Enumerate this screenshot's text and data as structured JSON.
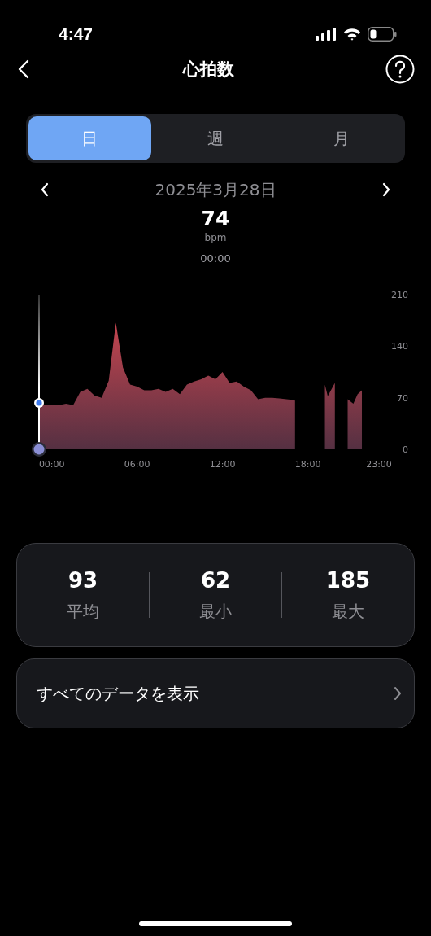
{
  "status_bar": {
    "time": "4:47"
  },
  "header": {
    "title": "心拍数"
  },
  "tabs": [
    {
      "label": "日",
      "selected": true
    },
    {
      "label": "週",
      "selected": false
    },
    {
      "label": "月",
      "selected": false
    }
  ],
  "date": "2025年3月28日",
  "readout": {
    "value": "74",
    "unit": "bpm",
    "time": "00:00"
  },
  "chart": {
    "chart_data": {
      "type": "area",
      "x": [
        -0.9,
        -0.5,
        0,
        0.5,
        1,
        1.5,
        2,
        2.5,
        3,
        3.5,
        4,
        4.5,
        5,
        5.5,
        6,
        6.5,
        7,
        7.5,
        8,
        8.5,
        9,
        9.5,
        10,
        10.5,
        11,
        11.5,
        12,
        12.5,
        13,
        13.5,
        14,
        14.5,
        15,
        15.5,
        16,
        16.5,
        17,
        17.1,
        19.2,
        19.4,
        19.9,
        20.8,
        21.2,
        21.5,
        21.8
      ],
      "values": [
        63,
        60,
        60,
        60,
        62,
        60,
        78,
        82,
        73,
        70,
        93,
        172,
        111,
        88,
        85,
        80,
        80,
        82,
        78,
        82,
        75,
        88,
        92,
        95,
        100,
        95,
        105,
        90,
        92,
        85,
        80,
        68,
        70,
        70,
        69,
        68,
        67,
        66,
        88,
        72,
        90,
        68,
        62,
        75,
        80
      ],
      "xlim": [
        -0.9,
        23
      ],
      "ylim": [
        0,
        210
      ],
      "xticks": [
        {
          "value": 0,
          "label": "00:00"
        },
        {
          "value": 6,
          "label": "06:00"
        },
        {
          "value": 12,
          "label": "12:00"
        },
        {
          "value": 18,
          "label": "18:00"
        },
        {
          "value": 23,
          "label": "23:00"
        }
      ],
      "yticks": [
        0,
        70,
        140,
        210
      ]
    }
  },
  "stats": [
    {
      "value": "93",
      "label": "平均"
    },
    {
      "value": "62",
      "label": "最小"
    },
    {
      "value": "185",
      "label": "最大"
    }
  ],
  "link": {
    "label": "すべてのデータを表示"
  }
}
